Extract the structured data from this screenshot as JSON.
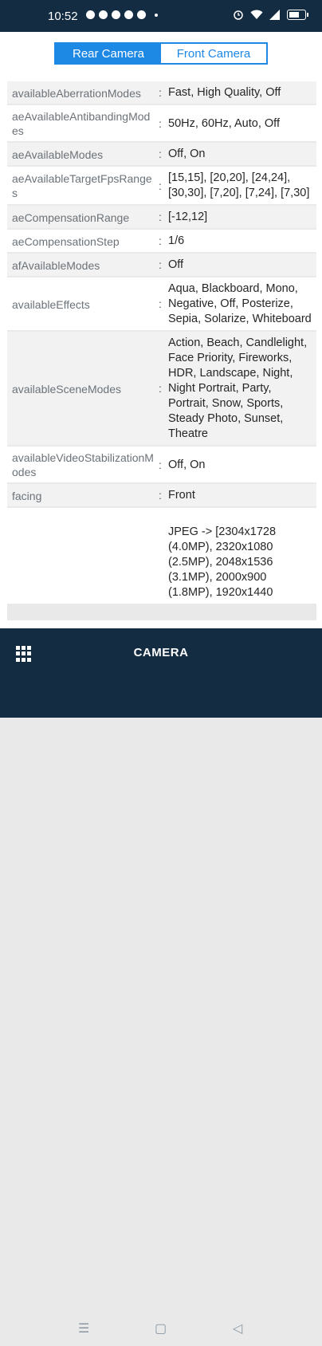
{
  "status_bar": {
    "time": "10:52",
    "left_icons": [
      "youtube-icon",
      "messenger-icon",
      "tiktok-icon",
      "instagram-icon",
      "pinterest-icon"
    ],
    "right_icons": [
      "alarm-icon",
      "wifi-icon",
      "signal-icon",
      "battery-icon"
    ]
  },
  "camera_tabs": [
    {
      "label": "Rear Camera",
      "active": true
    },
    {
      "label": "Front Camera",
      "active": false
    }
  ],
  "rows": [
    {
      "key": "availableAberrationModes",
      "value": "Fast, High Quality, Off"
    },
    {
      "key": "aeAvailableAntibandingModes",
      "value": "50Hz, 60Hz, Auto, Off"
    },
    {
      "key": "aeAvailableModes",
      "value": "Off, On"
    },
    {
      "key": "aeAvailableTargetFpsRanges",
      "value": "[15,15], [20,20], [24,24], [30,30], [7,20], [7,24], [7,30]"
    },
    {
      "key": "aeCompensationRange",
      "value": "[-12,12]"
    },
    {
      "key": "aeCompensationStep",
      "value": "1/6"
    },
    {
      "key": "afAvailableModes",
      "value": "Off"
    },
    {
      "key": "availableEffects",
      "value": "Aqua, Blackboard, Mono, Negative, Off, Posterize, Sepia, Solarize, Whiteboard"
    },
    {
      "key": "availableSceneModes",
      "value": "Action, Beach, Candlelight, Face Priority, Fireworks, HDR, Landscape, Night, Night Portrait, Party, Portrait, Snow, Sports, Steady Photo, Sunset, Theatre"
    },
    {
      "key": "availableVideoStabilizationModes",
      "value": "Off, On"
    },
    {
      "key": "facing",
      "value": "Front"
    },
    {
      "key": "",
      "value": "JPEG -> [2304x1728 (4.0MP), 2320x1080 (2.5MP), 2048x1536 (3.1MP), 2000x900 (1.8MP), 1920x1440"
    }
  ],
  "bottom_bar": {
    "title": "CAMERA",
    "menu_icon": "apps-grid-icon"
  },
  "nav": {
    "recents": "☰",
    "home": "▢",
    "back": "◁"
  }
}
